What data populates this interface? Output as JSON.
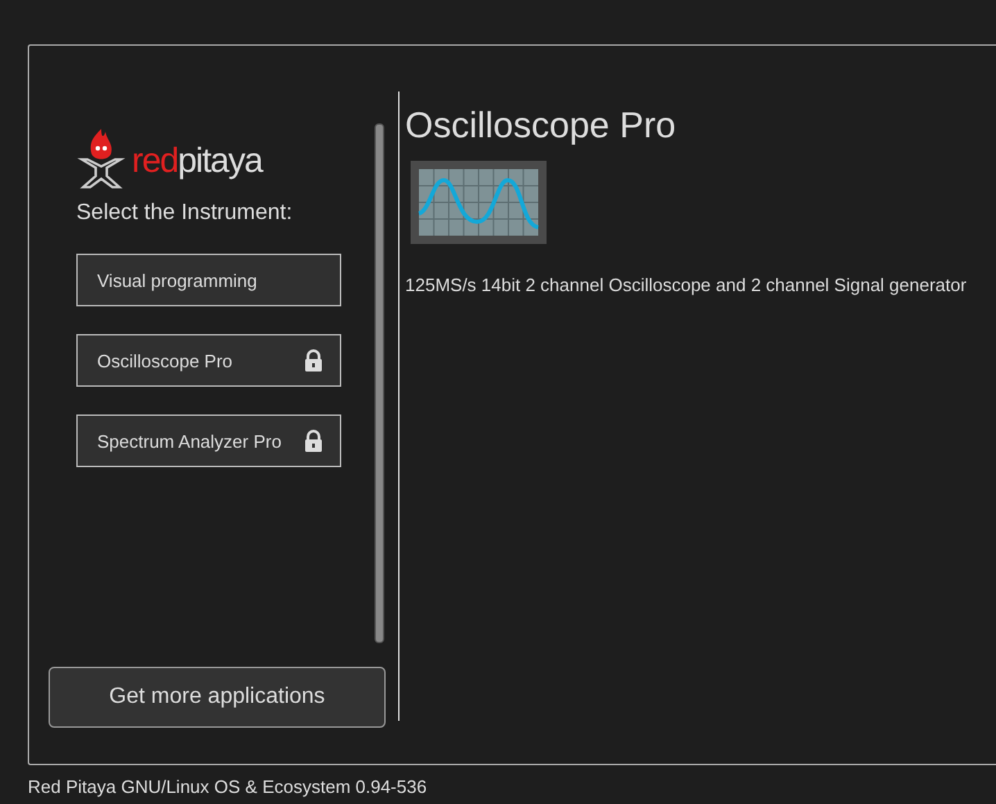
{
  "logo": {
    "brand_first": "red",
    "brand_second": "pitaya"
  },
  "prompt": "Select the Instrument:",
  "instruments": [
    {
      "label": "Visual programming",
      "locked": false
    },
    {
      "label": "Oscilloscope Pro",
      "locked": true
    },
    {
      "label": "Spectrum Analyzer Pro",
      "locked": true
    }
  ],
  "more_button": "Get more applications",
  "detail": {
    "title": "Oscilloscope Pro",
    "description": "125MS/s 14bit 2 channel Oscilloscope and 2 channel Signal generator"
  },
  "footer": "Red Pitaya GNU/Linux OS & Ecosystem 0.94-536"
}
